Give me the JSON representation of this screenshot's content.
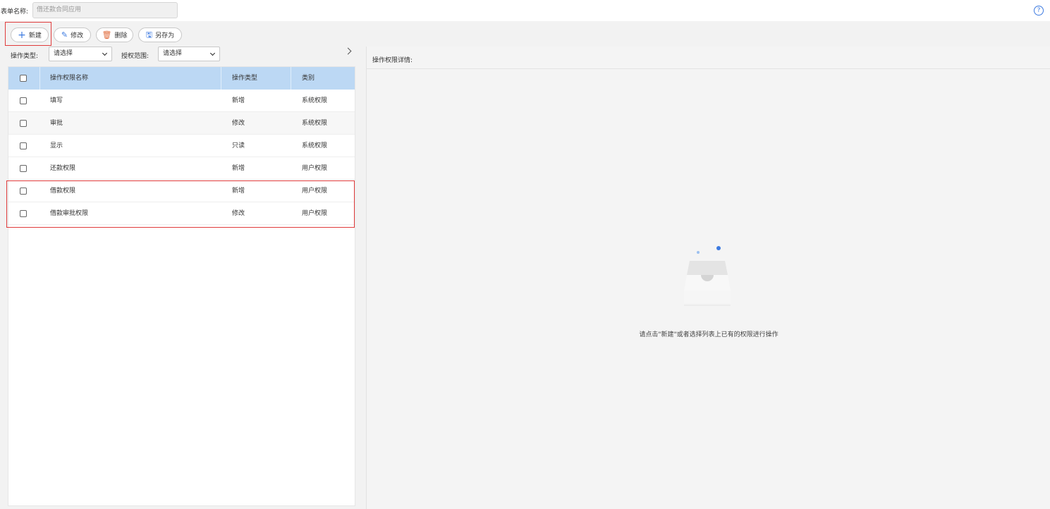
{
  "header": {
    "form_name_label": "表单名称:",
    "form_name_value": "借还款合同应用",
    "help_icon": "question-circle-icon"
  },
  "toolbar": {
    "new_label": "新建",
    "edit_label": "修改",
    "delete_label": "删除",
    "save_as_label": "另存为"
  },
  "filters": {
    "operation_type_label": "操作类型:",
    "operation_type_value": "请选择",
    "scope_label": "授权范围:",
    "scope_value": "请选择"
  },
  "table": {
    "columns": [
      "操作权限名称",
      "操作类型",
      "类别"
    ],
    "rows": [
      {
        "name": "填写",
        "type": "新增",
        "category": "系统权限"
      },
      {
        "name": "审批",
        "type": "修改",
        "category": "系统权限"
      },
      {
        "name": "显示",
        "type": "只读",
        "category": "系统权限"
      },
      {
        "name": "还款权限",
        "type": "新增",
        "category": "用户权限"
      },
      {
        "name": "借款权限",
        "type": "新增",
        "category": "用户权限"
      },
      {
        "name": "借款审批权限",
        "type": "修改",
        "category": "用户权限"
      }
    ]
  },
  "detail": {
    "title": "操作权限详情:",
    "empty_hint": "请点击\"新建\"或者选择列表上已有的权限进行操作"
  },
  "colors": {
    "accent": "#3c7ae0",
    "header_bg": "#bcd8f4",
    "highlight": "#e03c3c"
  }
}
